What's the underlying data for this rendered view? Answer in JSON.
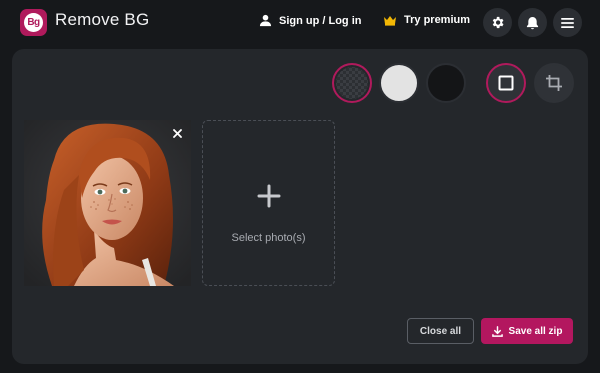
{
  "app": {
    "logo_text": "Bg",
    "name": "Remove BG"
  },
  "nav": {
    "signup_label": "Sign up / Log in",
    "premium_label": "Try premium",
    "icons": [
      "user-icon",
      "crown-icon",
      "gear-icon",
      "bell-icon",
      "menu-icon"
    ]
  },
  "toolbar": {
    "backgrounds": [
      "transparent",
      "white",
      "black"
    ],
    "selected_background": "transparent",
    "tools": [
      "original-size",
      "crop"
    ],
    "selected_tool": "original-size"
  },
  "workspace": {
    "photo_alt": "Portrait of a red-haired woman with freckles",
    "select_label": "Select photo(s)"
  },
  "actions": {
    "close_all_label": "Close all",
    "save_all_label": "Save all zip"
  },
  "colors": {
    "accent": "#b01a5c",
    "background": "#16181b",
    "panel": "#24272b",
    "premium_crown": "#f2b705"
  }
}
